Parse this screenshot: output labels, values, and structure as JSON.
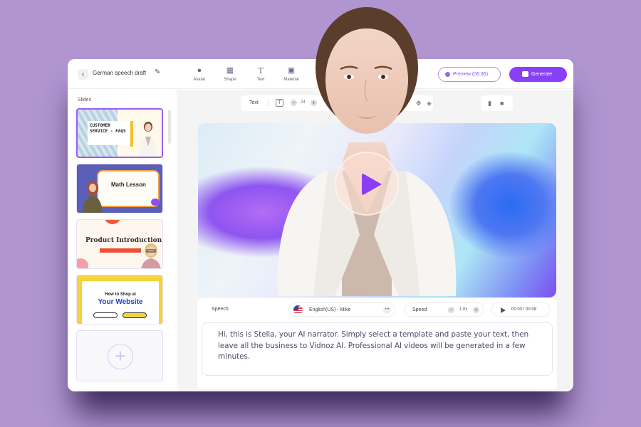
{
  "app": {
    "project_title": "German speech draft",
    "toolbar": {
      "tools": [
        {
          "label": "Avatar",
          "icon": "avatar-icon"
        },
        {
          "label": "Shape",
          "icon": "shape-icon"
        },
        {
          "label": "Text",
          "icon": "text-icon"
        },
        {
          "label": "Material",
          "icon": "material-icon"
        }
      ],
      "preview_label": "Preview (06:36)",
      "generate_label": "Generate"
    },
    "sidebar": {
      "title": "Slides",
      "slides": [
        {
          "title": "CUSTOMER SERVICE - FAQS",
          "selected": true
        },
        {
          "title": "Math Lesson",
          "selected": false
        },
        {
          "title": "Product Introduction",
          "selected": false
        },
        {
          "title_top": "How to Shop at",
          "title_main": "Your Website",
          "selected": false
        }
      ],
      "add_slide_icon": "+"
    },
    "format_bar": {
      "label": "Text",
      "font_size": "24"
    },
    "speech": {
      "label": "Speech",
      "voice": "English(US) - Mike",
      "speed_label": "Speed",
      "speed_value": "1.0x",
      "time": "00:03 / 00:08",
      "script": "Hi, this is Stella, your AI narrator. Simply select a template and paste your text, then leave all the business to Vidnoz AI. Professional AI videos will be generated in a few minutes."
    },
    "colors": {
      "accent": "#8740f5",
      "background": "#b095d1"
    }
  }
}
